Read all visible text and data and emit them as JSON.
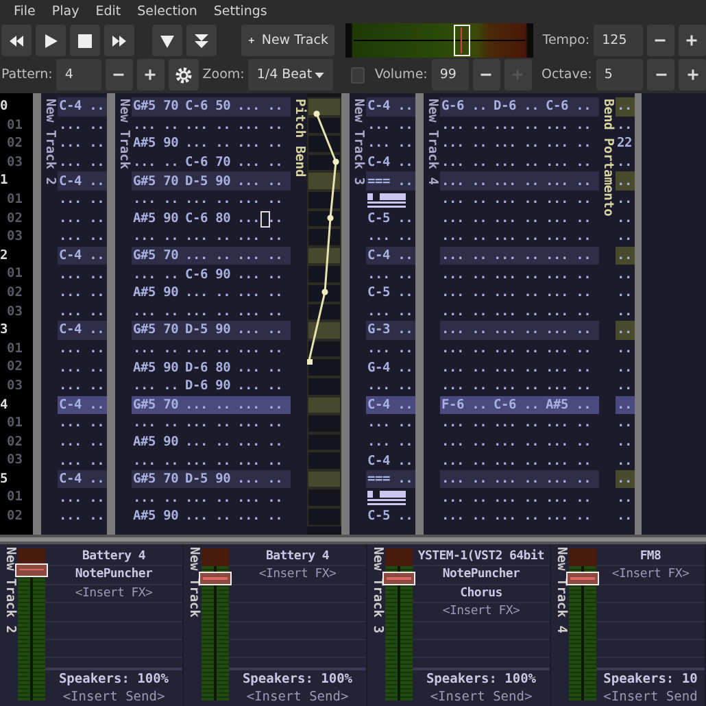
{
  "menu": [
    "File",
    "Play",
    "Edit",
    "Selection",
    "Settings"
  ],
  "toolbar": {
    "new_track": "New Track",
    "meter": {
      "level": 0.62
    },
    "tempo": {
      "label": "Tempo:",
      "value": "125"
    }
  },
  "options_bar": {
    "pattern": {
      "label": "Pattern:",
      "value": "4"
    },
    "zoom": {
      "label": "Zoom:",
      "value": "1/4 Beat"
    },
    "follow": {
      "checked": false
    },
    "volume": {
      "label": "Volume:",
      "value": "99",
      "plus_disabled": true
    },
    "octave": {
      "label": "Octave:",
      "value": "5"
    }
  },
  "pattern_editor": {
    "rows": [
      {
        "label": "0",
        "beat": true,
        "current": false
      },
      {
        "label": "01",
        "beat": false,
        "current": false
      },
      {
        "label": "02",
        "beat": false,
        "current": false
      },
      {
        "label": "03",
        "beat": false,
        "current": false
      },
      {
        "label": "1",
        "beat": true,
        "current": false
      },
      {
        "label": "01",
        "beat": false,
        "current": false
      },
      {
        "label": "02",
        "beat": false,
        "current": false
      },
      {
        "label": "03",
        "beat": false,
        "current": false
      },
      {
        "label": "2",
        "beat": true,
        "current": false
      },
      {
        "label": "01",
        "beat": false,
        "current": false
      },
      {
        "label": "02",
        "beat": false,
        "current": false
      },
      {
        "label": "03",
        "beat": false,
        "current": false
      },
      {
        "label": "3",
        "beat": true,
        "current": false
      },
      {
        "label": "01",
        "beat": false,
        "current": false
      },
      {
        "label": "02",
        "beat": false,
        "current": false
      },
      {
        "label": "03",
        "beat": false,
        "current": false
      },
      {
        "label": "4",
        "beat": true,
        "current": true
      },
      {
        "label": "01",
        "beat": false,
        "current": false
      },
      {
        "label": "02",
        "beat": false,
        "current": false
      },
      {
        "label": "03",
        "beat": false,
        "current": false
      },
      {
        "label": "5",
        "beat": true,
        "current": false
      },
      {
        "label": "01",
        "beat": false,
        "current": false
      },
      {
        "label": "02",
        "beat": false,
        "current": false
      }
    ],
    "columns": [
      {
        "kind": "notes",
        "name": "New Track 2",
        "cells": [
          [
            "C-4 .."
          ],
          [
            "... .."
          ],
          [
            "... .."
          ],
          [
            "... .."
          ],
          [
            "C-4 .."
          ],
          [
            "... .."
          ],
          [
            "... .."
          ],
          [
            "... .."
          ],
          [
            "C-4 .."
          ],
          [
            "... .."
          ],
          [
            "... .."
          ],
          [
            "... .."
          ],
          [
            "C-4 .."
          ],
          [
            "... .."
          ],
          [
            "... .."
          ],
          [
            "... .."
          ],
          [
            "C-4 .."
          ],
          [
            "... .."
          ],
          [
            "... .."
          ],
          [
            "... .."
          ],
          [
            "C-4 .."
          ],
          [
            "... .."
          ],
          [
            "... .."
          ]
        ]
      },
      {
        "kind": "notes",
        "name": "New Track",
        "cells": [
          [
            "G#5 70",
            "C-6 50",
            "... .."
          ],
          [
            "... ..",
            "... ..",
            "... .."
          ],
          [
            "A#5 90",
            "... ..",
            "... .."
          ],
          [
            "... ..",
            "C-6 70",
            "... .."
          ],
          [
            "G#5 70",
            "D-5 90",
            "... .."
          ],
          [
            "... ..",
            "... ..",
            "... .."
          ],
          {
            "cells": [
              "A#5 90",
              "C-6 80",
              "... .."
            ],
            "cursor": true
          },
          [
            "... ..",
            "... ..",
            "... .."
          ],
          [
            "G#5 70",
            "... ..",
            "... .."
          ],
          [
            "... ..",
            "C-6 90",
            "... .."
          ],
          [
            "A#5 90",
            "... ..",
            "... .."
          ],
          [
            "... ..",
            "... ..",
            "... .."
          ],
          [
            "G#5 70",
            "D-5 90",
            "... .."
          ],
          [
            "... ..",
            "... ..",
            "... .."
          ],
          [
            "A#5 90",
            "D-6 80",
            "... .."
          ],
          [
            "... ..",
            "D-6 90",
            "... .."
          ],
          [
            "G#5 70",
            "... ..",
            "... .."
          ],
          [
            "... ..",
            "... ..",
            "... .."
          ],
          [
            "A#5 90",
            "... ..",
            "... .."
          ],
          [
            "... ..",
            "... ..",
            "... .."
          ],
          [
            "G#5 70",
            "D-5 90",
            "... .."
          ],
          [
            "... ..",
            "... ..",
            "... .."
          ],
          [
            "A#5 90",
            "... ..",
            "... .."
          ]
        ]
      },
      {
        "kind": "automation",
        "name": "Pitch Bend"
      },
      {
        "kind": "notes",
        "name": "New Track 3",
        "cells": [
          [
            "C-4 .."
          ],
          [
            "... .."
          ],
          [
            "... .."
          ],
          [
            "C-4 .."
          ],
          [
            "=== .."
          ],
          {
            "kind": "release"
          },
          [
            "C-5 .."
          ],
          [
            "... .."
          ],
          [
            "C-4 .."
          ],
          [
            "... .."
          ],
          [
            "C-5 .."
          ],
          [
            "... .."
          ],
          [
            "G-3 .."
          ],
          [
            "... .."
          ],
          [
            "G-4 .."
          ],
          [
            "... .."
          ],
          [
            "C-4 .."
          ],
          [
            "... .."
          ],
          [
            "... .."
          ],
          [
            "C-4 .."
          ],
          [
            "=== .."
          ],
          {
            "kind": "release"
          },
          [
            "C-5 .."
          ]
        ]
      },
      {
        "kind": "notes",
        "name": "New Track 4",
        "cells": [
          [
            "G-6 ..",
            "D-6 ..",
            "C-6 .."
          ],
          [
            "... ..",
            "... ..",
            "... .."
          ],
          [
            "... ..",
            "... ..",
            "... .."
          ],
          [
            "... ..",
            "... ..",
            "... .."
          ],
          [
            "... ..",
            "... ..",
            "... .."
          ],
          [
            "... ..",
            "... ..",
            "... .."
          ],
          [
            "... ..",
            "... ..",
            "... .."
          ],
          [
            "... ..",
            "... ..",
            "... .."
          ],
          [
            "... ..",
            "... ..",
            "... .."
          ],
          [
            "... ..",
            "... ..",
            "... .."
          ],
          [
            "... ..",
            "... ..",
            "... .."
          ],
          [
            "... ..",
            "... ..",
            "... .."
          ],
          [
            "... ..",
            "... ..",
            "... .."
          ],
          [
            "... ..",
            "... ..",
            "... .."
          ],
          [
            "... ..",
            "... ..",
            "... .."
          ],
          [
            "... ..",
            "... ..",
            "... .."
          ],
          [
            "F-6 ..",
            "C-6 ..",
            "A#5 .."
          ],
          [
            "... ..",
            "... ..",
            "... .."
          ],
          [
            "... ..",
            "... ..",
            "... .."
          ],
          [
            "... ..",
            "... ..",
            "... .."
          ],
          [
            "... ..",
            "... ..",
            "... .."
          ],
          [
            "... ..",
            "... ..",
            "... .."
          ],
          [
            "... ..",
            "... ..",
            "... .."
          ]
        ]
      },
      {
        "kind": "effect",
        "name": "Bend Portamento",
        "cells": [
          [
            ".."
          ],
          [
            ".."
          ],
          [
            "22"
          ],
          [
            ".."
          ],
          [
            ".."
          ],
          [
            ".."
          ],
          [
            ".."
          ],
          [
            ".."
          ],
          [
            ".."
          ],
          [
            ".."
          ],
          [
            ".."
          ],
          [
            ".."
          ],
          [
            ".."
          ],
          [
            ".."
          ],
          [
            ".."
          ],
          [
            ".."
          ],
          [
            ".."
          ],
          [
            ".."
          ],
          [
            ".."
          ],
          [
            ".."
          ],
          [
            ".."
          ],
          [
            ".."
          ],
          [
            ".."
          ]
        ]
      }
    ]
  },
  "mixer": {
    "strips": [
      {
        "name": "New Track 2",
        "level": 0.86,
        "effects": [
          "Battery 4",
          "NotePuncher",
          "<Insert FX>"
        ],
        "send": "Speakers: 100%",
        "insert_send": "<Insert Send>"
      },
      {
        "name": "New Track",
        "level": 0.8,
        "effects": [
          "Battery 4",
          "<Insert FX>"
        ],
        "send": "Speakers: 100%",
        "insert_send": "<Insert Send>"
      },
      {
        "name": "New Track 3",
        "level": 0.8,
        "effects": [
          "YSTEM-1(VST2 64bit",
          "NotePuncher",
          "Chorus",
          "<Insert FX>"
        ],
        "send": "Speakers: 100%",
        "insert_send": "<Insert Send>"
      },
      {
        "name": "New Track 4",
        "level": 0.8,
        "effects": [
          "FM8",
          "<Insert FX>"
        ],
        "send": "Speakers: 10",
        "insert_send": "<Insert Send"
      }
    ]
  }
}
